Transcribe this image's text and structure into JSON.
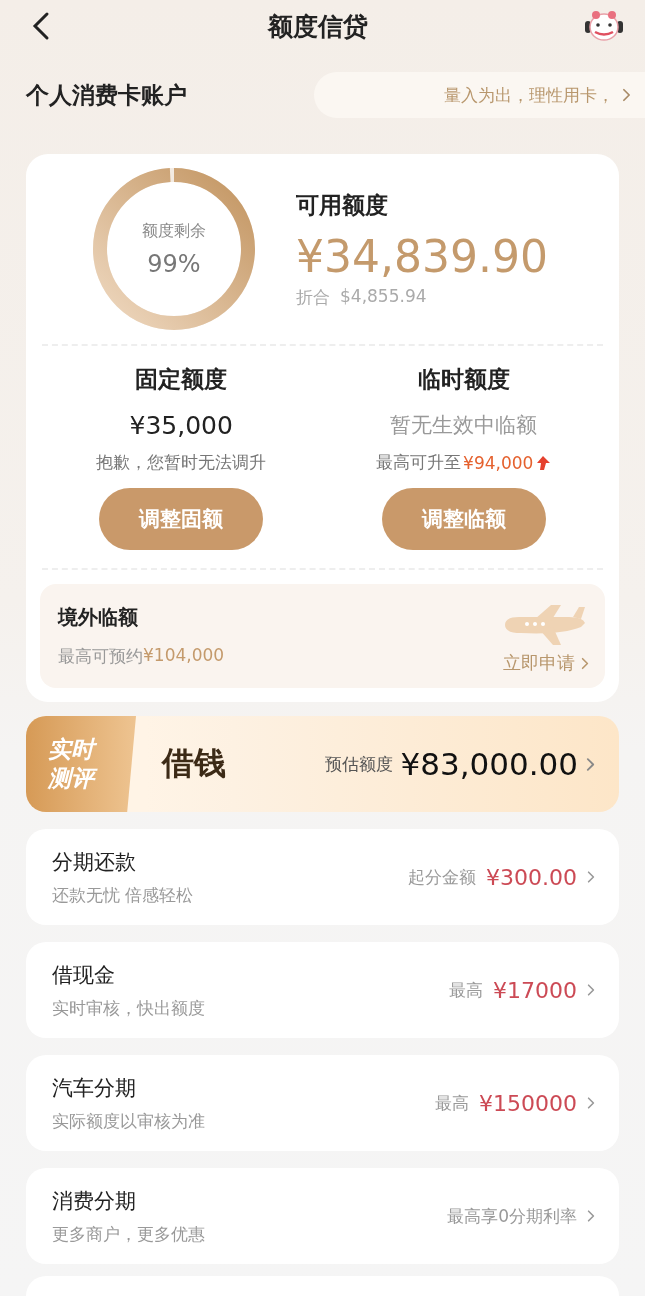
{
  "header": {
    "title": "额度信贷"
  },
  "account": {
    "title": "个人消费卡账户",
    "notice": "量入为出，理性用卡，"
  },
  "overview": {
    "ring_label": "额度剩余",
    "ring_value": "99%",
    "level": 0.99,
    "available_label": "可用额度",
    "available_amount": "¥34,839.90",
    "converted_label": "折合",
    "converted_amount": "$4,855.94"
  },
  "limits": [
    {
      "kind": "amount",
      "title": "固定额度",
      "value": "¥35,000",
      "note": "抱歉，您暂时无法调升",
      "button": "调整固额"
    },
    {
      "kind": "status",
      "title": "临时额度",
      "value": "暂无生效中临额",
      "note": "最高可升至",
      "note_amount": "¥94,000",
      "button": "调整临额"
    }
  ],
  "overseas": {
    "title": "境外临额",
    "note": "最高可预约",
    "note_amount": "¥104,000",
    "link": "立即申请"
  },
  "loan_banner": {
    "badge": [
      "实时",
      "测评"
    ],
    "title": "借钱",
    "label": "预估额度",
    "amount": "¥83,000.00"
  },
  "services": [
    {
      "title": "分期还款",
      "subtitle": "还款无忧 倍感轻松",
      "label": "起分金额",
      "amount": "¥300.00"
    },
    {
      "title": "借现金",
      "subtitle": "实时审核，快出额度",
      "label": "最高",
      "amount": "¥17000"
    },
    {
      "title": "汽车分期",
      "subtitle": "实际额度以审核为准",
      "label": "最高",
      "amount": "¥150000"
    },
    {
      "title": "消费分期",
      "subtitle": "更多商户，更多优惠",
      "label": "最高享0分期利率"
    }
  ]
}
